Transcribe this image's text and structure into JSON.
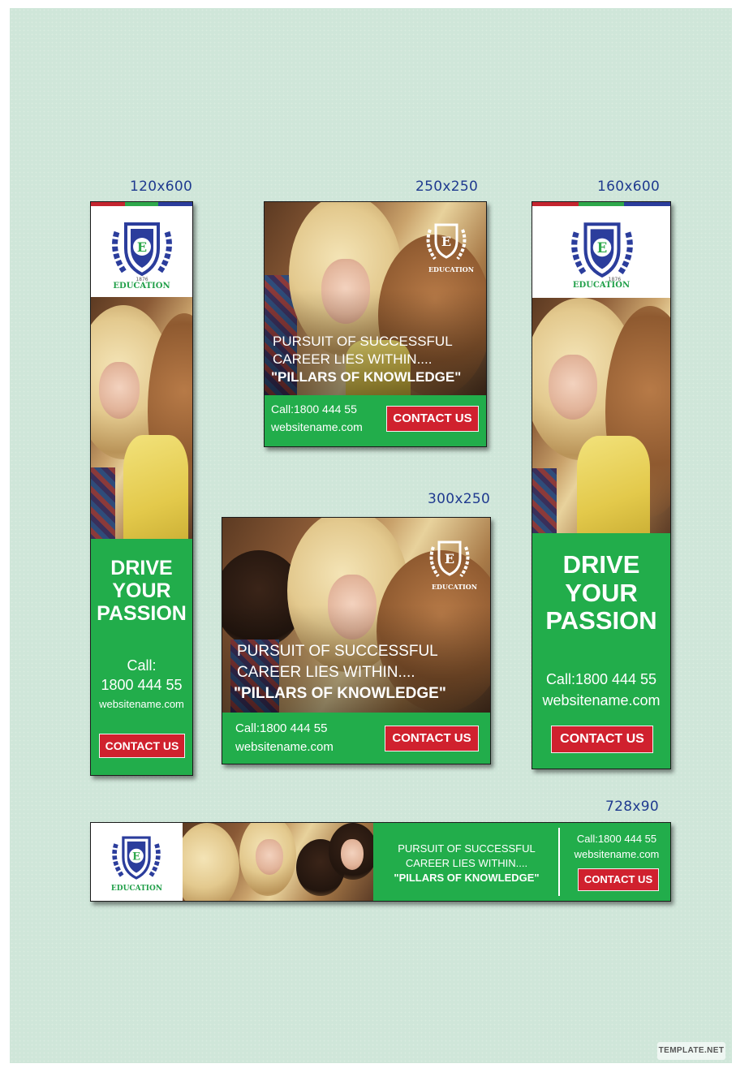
{
  "colors": {
    "background": "#cfe6d9",
    "label_blue": "#1f3a8f",
    "brand_green": "#22ad4b",
    "cta_red": "#d0212e",
    "stripe_red": "#c4252f",
    "stripe_green": "#2ea84b",
    "stripe_blue": "#2b3d9c"
  },
  "labels": {
    "size_120x600": "120x600",
    "size_250x250": "250x250",
    "size_160x600": "160x600",
    "size_300x250": "300x250",
    "size_728x90": "728x90"
  },
  "logo": {
    "text": "EDUCATION",
    "letter": "E",
    "year": "1876",
    "icon": "laurel-shield-icon"
  },
  "copy": {
    "headline_lines": [
      "DRIVE",
      "YOUR",
      "PASSION"
    ],
    "tagline_line1": "PURSUIT OF SUCCESSFUL",
    "tagline_line2": "CAREER LIES WITHIN....",
    "tagline_quote": "\"PILLARS OF KNOWLEDGE\"",
    "call_label": "Call:",
    "phone_number": "1800 444 55",
    "call_full": "Call:1800 444 55",
    "website": "websitename.com",
    "cta": "CONTACT US"
  },
  "watermark": "TEMPLATE.NET"
}
